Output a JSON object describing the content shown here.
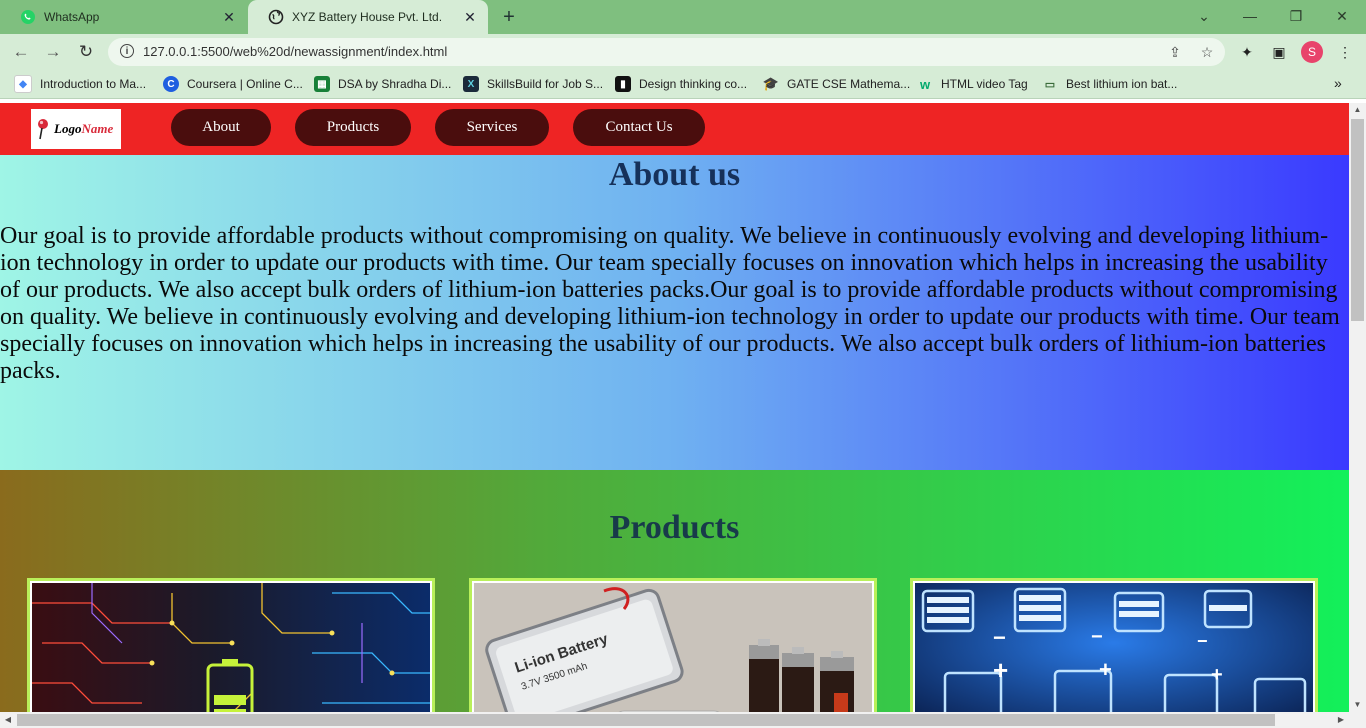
{
  "browser": {
    "tabs": [
      {
        "label": "WhatsApp",
        "icon": "whatsapp-icon"
      },
      {
        "label": "XYZ Battery House Pvt. Ltd.",
        "icon": "globe-icon"
      }
    ],
    "url": "127.0.0.1:5500/web%20d/newassignment/index.html",
    "profile_initial": "S",
    "bookmarks": [
      {
        "label": "Introduction to Ma...",
        "icon": "google-colors-icon",
        "color": "#4285f4"
      },
      {
        "label": "Coursera | Online C...",
        "icon": "coursera-icon",
        "color": "#1f5fe0"
      },
      {
        "label": "DSA by Shradha Di...",
        "icon": "sheets-icon",
        "color": "#188038"
      },
      {
        "label": "SkillsBuild for Job S...",
        "icon": "skillsbuild-icon",
        "color": "#1b2a3a"
      },
      {
        "label": "Design thinking co...",
        "icon": "design-thinking-icon",
        "color": "#111111"
      },
      {
        "label": "GATE CSE Mathema...",
        "icon": "graduation-cap-icon",
        "color": "#1a8fd0"
      },
      {
        "label": "HTML video Tag",
        "icon": "w3schools-icon",
        "color": "#04aa6d"
      },
      {
        "label": "Best lithium ion bat...",
        "icon": "battery-site-icon",
        "color": "#3a6b3a"
      }
    ]
  },
  "site": {
    "logo": {
      "part1": "Logo",
      "part2": "Name"
    },
    "nav": [
      "About",
      "Products",
      "Services",
      "Contact Us"
    ],
    "about": {
      "heading": "About us",
      "body": "Our goal is to provide affordable products without compromising on quality. We believe in continuously evolving and developing lithium-ion technology in order to update our products with time. Our team specially focuses on innovation which helps in increasing the usability of our products. We also accept bulk orders of lithium-ion batteries packs.Our goal is to provide affordable products without compromising on quality. We believe in continuously evolving and developing lithium-ion technology in order to update our products with time. Our team specially focuses on innovation which helps in increasing the usability of our products. We also accept bulk orders of lithium-ion batteries packs."
    },
    "products": {
      "heading": "Products",
      "cards": [
        {
          "image": "circuit-board-battery-image"
        },
        {
          "image": "li-ion-battery-cells-image",
          "image_text_1": "Li-ion Battery",
          "image_text_2": "3.7V 3500 mAh"
        },
        {
          "image": "battery-charge-icons-image"
        }
      ]
    }
  },
  "colors": {
    "nav_bar": "#ee2424",
    "nav_pill": "#4a0d0d",
    "about_gradient": [
      "#9ff5e6",
      "#6fb1f1",
      "#3a3aff"
    ],
    "products_gradient": [
      "#8a6b1d",
      "#52a93a",
      "#13f05a"
    ]
  }
}
